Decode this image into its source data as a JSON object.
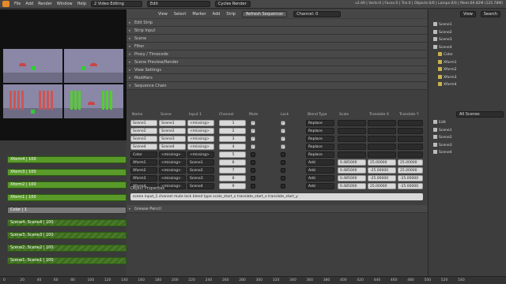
{
  "topbar": {
    "menus": [
      "File",
      "Add",
      "Render",
      "Window",
      "Help"
    ],
    "screen": "2 Video Editing",
    "scene": "Edit",
    "engine": "Cycles Render",
    "stats": "v2.69 | Verts:0 | Faces:0 | Tris:0 | Objects:0/0 | Lamps:0/0 | Mem:69.82M (125.78M)"
  },
  "seqheader": {
    "menus": [
      "View",
      "Select",
      "Marker",
      "Add",
      "Strip"
    ],
    "refresh": "Refresh Sequencer",
    "channel": "Channel: 0"
  },
  "props": {
    "panels": [
      "Edit Strip",
      "Strip Input",
      "Scene",
      "Filter",
      "Proxy / Timecode",
      "Scene Preview/Render",
      "View Settings",
      "Modifiers"
    ],
    "open_panel": "Sequence Chain",
    "object_props": "Object Properties",
    "object_value": "scene input_1 channel mute lock blend type scale_start_x translate_start_x translate_start_y",
    "gp": "Grease Pencil"
  },
  "rows": [
    {
      "name": "Scene1",
      "src": "Scene1",
      "input": "<missing>",
      "ch": "1",
      "m": true,
      "l": true,
      "blend": "Replace",
      "a": "",
      "b": "",
      "c": ""
    },
    {
      "name": "Scene2",
      "src": "Scene2",
      "input": "<missing>",
      "ch": "2",
      "m": true,
      "l": true,
      "blend": "Replace",
      "a": "",
      "b": "",
      "c": ""
    },
    {
      "name": "Scene3",
      "src": "Scene3",
      "input": "<missing>",
      "ch": "3",
      "m": true,
      "l": true,
      "blend": "Replace",
      "a": "",
      "b": "",
      "c": ""
    },
    {
      "name": "Scene4",
      "src": "Scene4",
      "input": "<missing>",
      "ch": "4",
      "m": true,
      "l": true,
      "blend": "Replace",
      "a": "",
      "b": "",
      "c": ""
    },
    {
      "name": "Color",
      "src": "<missing>",
      "input": "<missing>",
      "ch": "5",
      "m": false,
      "l": false,
      "blend": "Replace",
      "a": "",
      "b": "",
      "c": ""
    },
    {
      "name": "Xform1",
      "src": "<missing>",
      "input": "Scene1",
      "ch": "6",
      "m": false,
      "l": false,
      "blend": "Add",
      "a": "0.485000",
      "b": "25.00000",
      "c": "25.00000"
    },
    {
      "name": "Xform2",
      "src": "<missing>",
      "input": "Scene2",
      "ch": "7",
      "m": false,
      "l": false,
      "blend": "Add",
      "a": "0.485000",
      "b": "-25.00000",
      "c": "25.00000"
    },
    {
      "name": "Xform3",
      "src": "<missing>",
      "input": "Scene3",
      "ch": "8",
      "m": false,
      "l": false,
      "blend": "Add",
      "a": "0.485000",
      "b": "-25.00000",
      "c": "-25.00000"
    },
    {
      "name": "Xform4",
      "src": "<missing>",
      "input": "Scene4",
      "ch": "9",
      "m": false,
      "l": false,
      "blend": "Add",
      "a": "0.485000",
      "b": "25.00000",
      "c": "-25.00000"
    }
  ],
  "strips": [
    "Xform4 | 100",
    "Xform3 | 100",
    "Xform2 | 100",
    "Xform1 | 100",
    "Color | 1",
    "Scene4: Scene4 | 100",
    "Scene3: Scene3 | 100",
    "Scene2: Scene2 | 100",
    "Scene1: Scene1 | 100"
  ],
  "ruler": [
    "0",
    "20",
    "40",
    "60",
    "80",
    "100",
    "120",
    "140",
    "160",
    "180",
    "200",
    "220",
    "240",
    "260",
    "280",
    "300",
    "320",
    "340",
    "360",
    "380",
    "400",
    "420",
    "440",
    "460",
    "480",
    "500",
    "520",
    "540"
  ],
  "outliner": {
    "tabs": [
      "View",
      "Search"
    ],
    "top": [
      "Scene1",
      "Scene2",
      "Scene3",
      "Scene4",
      "Color",
      "Xform1",
      "Xform2",
      "Xform3",
      "Xform4"
    ],
    "filter": "All Scenes",
    "bottom": [
      "Edit",
      "Scene1",
      "Scene2",
      "Scene3",
      "Scene4"
    ]
  }
}
